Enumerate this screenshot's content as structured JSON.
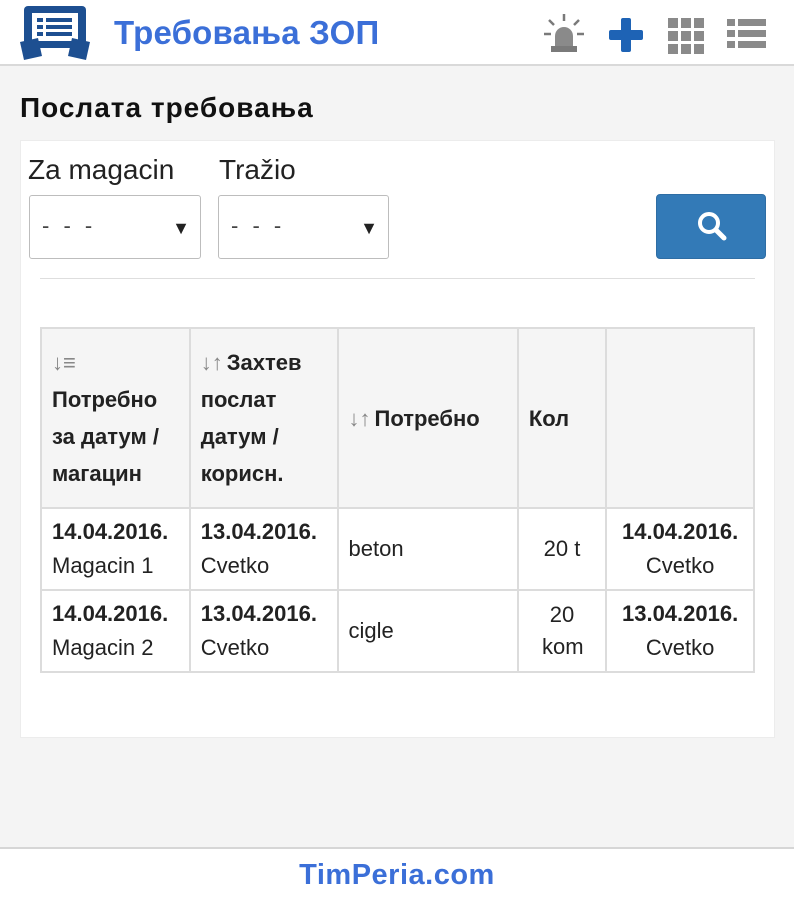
{
  "header": {
    "title": "Требовања ЗОП",
    "icons": [
      "app-logo-icon",
      "alarm-light-icon",
      "plus-icon",
      "grid-icon",
      "list-icon"
    ],
    "accent_color": "#3b6fd8"
  },
  "page": {
    "heading": "Послата требовања"
  },
  "filters": {
    "warehouse": {
      "label": "Za magacin",
      "value": "- - -"
    },
    "requester": {
      "label": "Tražio",
      "value": "- - -"
    },
    "search_button_icon": "search-icon",
    "button_color": "#337ab7"
  },
  "table": {
    "headers": {
      "col1_sort": "↓≡",
      "col1": "Потребно за датум / магацин",
      "col2_sort": "↓↑",
      "col2": "Захтев послат датум / корисн.",
      "col3_sort": "↓↑",
      "col3": "Потребно",
      "col4": "Кол",
      "col5": ""
    },
    "rows": [
      {
        "needed_date": "14.04.2016.",
        "warehouse": "Magacin 1",
        "sent_date": "13.04.2016.",
        "user": "Cvetko",
        "item": "beton",
        "qty": "20 t",
        "last_date": "14.04.2016.",
        "last_user": "Cvetko"
      },
      {
        "needed_date": "14.04.2016.",
        "warehouse": "Magacin 2",
        "sent_date": "13.04.2016.",
        "user": "Cvetko",
        "item": "cigle",
        "qty": "20 kom",
        "last_date": "13.04.2016.",
        "last_user": "Cvetko"
      }
    ]
  },
  "footer": {
    "text": "TimPeria.com"
  }
}
